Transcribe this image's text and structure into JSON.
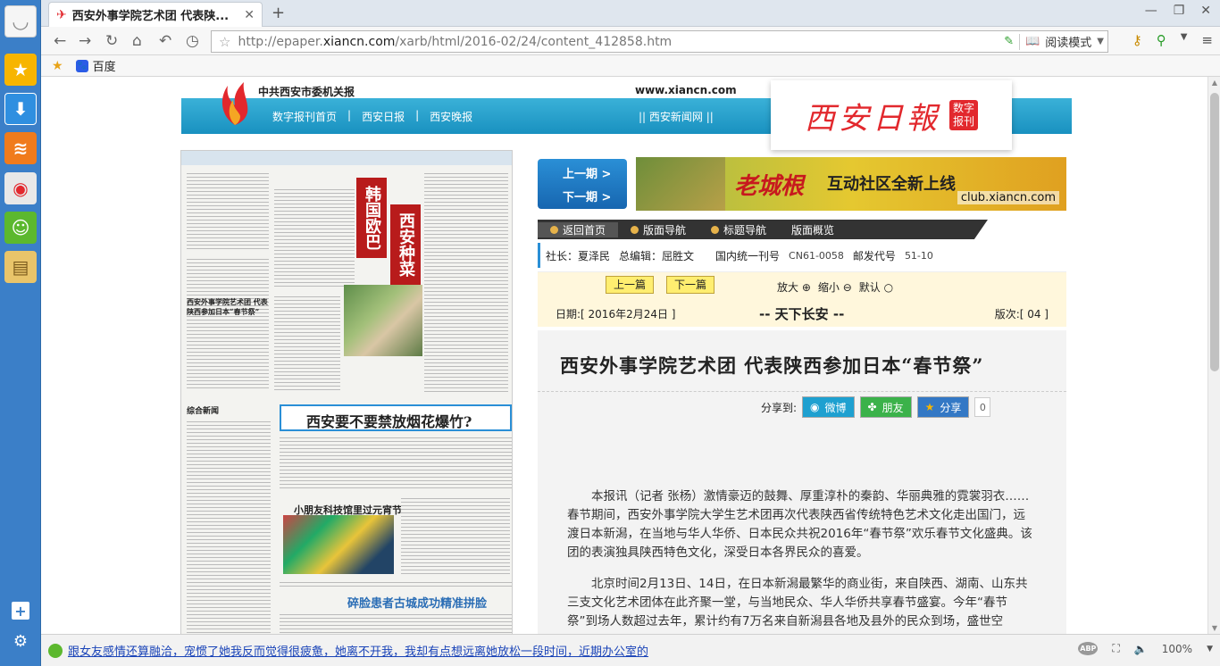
{
  "browser": {
    "tab_title": "西安外事学院艺术团 代表陕...",
    "new_tab_icon": "plus-icon",
    "url_prefix": "http://epaper.",
    "url_domain": "xiancn.com",
    "url_path": "/xarb/html/2016-02/24/content_412858.htm",
    "reading_mode": "阅读模式",
    "bookmarks": [
      {
        "label": "百度"
      }
    ]
  },
  "site": {
    "party_text": "中共西安市委机关报",
    "url": "www.xiancn.com",
    "nav": [
      "数字报刊首页",
      "西安日报",
      "西安晚报"
    ],
    "news_link": "|| 西安新闻网 ||",
    "paper_title": "西安日報",
    "paper_badge_1": "数字",
    "paper_badge_2": "报刊"
  },
  "thumb": {
    "red1": "韩国欧巴",
    "red2": "西安种菜",
    "headline1": "西安要不要禁放烟花爆竹?",
    "headline2": "小朋友科技馆里过元宵节",
    "headline3": "碎脸患者古城成功精准拼脸",
    "side1": "综合新闻",
    "side2": "西安外事学院艺术团 代表陕西参加日本“春节祭”"
  },
  "prev_next": {
    "prev": "上一期 >",
    "next": "下一期 >"
  },
  "ad": {
    "brand": "老城根",
    "slogan": "互动社区全新上线",
    "url": "club.xiancn.com"
  },
  "section_nav": [
    "返回首页",
    "版面导航",
    "标题导航",
    "版面概览"
  ],
  "meta": {
    "president": "社长：夏泽民",
    "editor": "总编辑：屈胜文",
    "cn": "国内统一刊号",
    "cn_val": "CN61-0058",
    "post": "邮发代号",
    "post_val": "51-10"
  },
  "pager": {
    "prev": "上一篇",
    "next": "下一篇",
    "zoom_in": "放大",
    "zoom_out": "缩小",
    "default": "默认"
  },
  "info": {
    "date": "日期:[ 2016年2月24日 ]",
    "section": "-- 天下长安 --",
    "page": "版次:[ 04 ]"
  },
  "article": {
    "title": "西安外事学院艺术团 代表陕西参加日本“春节祭”",
    "share_label": "分享到:",
    "share_weibo": "微博",
    "share_friends": "朋友",
    "share_more": "分享",
    "share_count": "0",
    "para1": "本报讯（记者 张杨）激情豪迈的鼓舞、厚重淳朴的秦韵、华丽典雅的霓裳羽衣……春节期间，西安外事学院大学生艺术团再次代表陕西省传统特色艺术文化走出国门，远渡日本新潟，在当地与华人华侨、日本民众共祝2016年“春节祭”欢乐春节文化盛典。该团的表演独具陕西特色文化，深受日本各界民众的喜爱。",
    "para2": "北京时间2月13日、14日，在日本新潟最繁华的商业街，来自陕西、湖南、山东共三支文化艺术团体在此齐聚一堂，与当地民众、华人华侨共享春节盛宴。今年“春节祭”到场人数超过去年，累计约有7万名来自新潟县各地及县外的民众到场，盛世空"
  },
  "status": {
    "text": "跟女友感情还算融洽，宠惯了她我反而觉得很疲惫，她离不开我，我却有点想远离她放松一段时间，近期办公室的",
    "zoom": "100%"
  }
}
